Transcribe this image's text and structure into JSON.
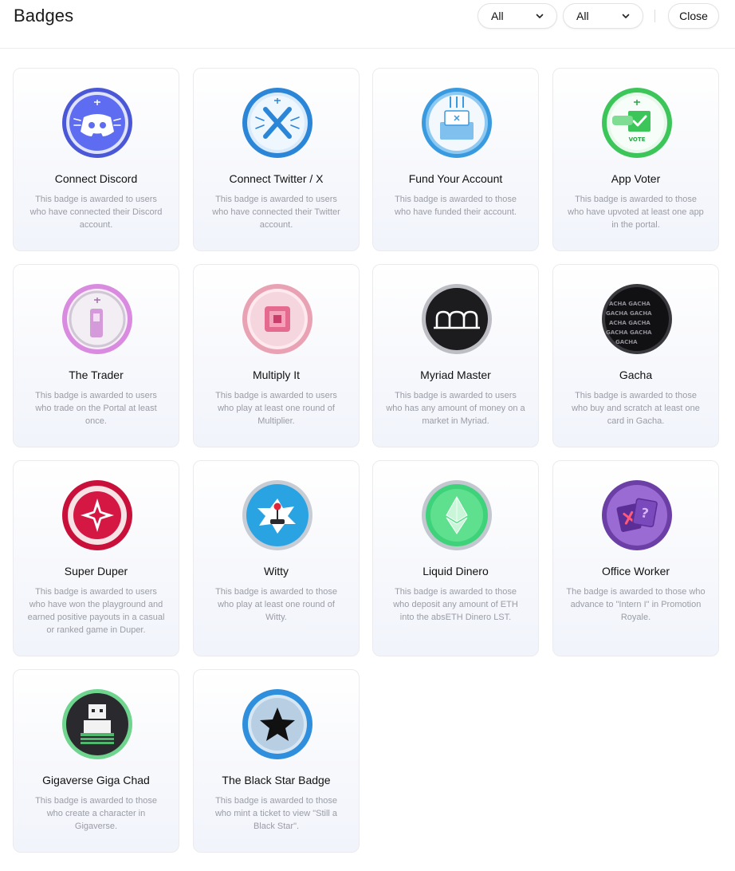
{
  "header": {
    "title": "Badges",
    "filter1": "All",
    "filter2": "All",
    "close_label": "Close"
  },
  "colors": {
    "border": "#ebebef",
    "desc_text": "#9a9ca6",
    "card_bg_bottom": "#f1f4fb"
  },
  "badges": [
    {
      "name": "Connect Discord",
      "desc": "This badge is awarded to users who have connected their Discord account.",
      "icon": "discord-icon"
    },
    {
      "name": "Connect Twitter / X",
      "desc": "This badge is awarded to users who have connected their Twitter account.",
      "icon": "x-logo-icon"
    },
    {
      "name": "Fund Your Account",
      "desc": "This badge is awarded to those who have funded their account.",
      "icon": "fund-box-icon"
    },
    {
      "name": "App Voter",
      "desc": "This badge is awarded to those who have upvoted at least one app in the portal.",
      "icon": "vote-check-icon"
    },
    {
      "name": "The Trader",
      "desc": "This badge is awarded to users who trade on the Portal at least once.",
      "icon": "trader-icon"
    },
    {
      "name": "Multiply It",
      "desc": "This badge is awarded to users who play at least one round of Multiplier.",
      "icon": "multiplier-icon"
    },
    {
      "name": "Myriad Master",
      "desc": "This badge is awarded to users who has any amount of money on a market in Myriad.",
      "icon": "myriad-icon"
    },
    {
      "name": "Gacha",
      "desc": "This badge is awarded to those who buy and scratch at least one card in Gacha.",
      "icon": "gacha-icon"
    },
    {
      "name": "Super Duper",
      "desc": "This badge is awarded to users who have won the playground and earned positive payouts in a casual or ranked game in Duper.",
      "icon": "star-compass-icon"
    },
    {
      "name": "Witty",
      "desc": "This badge is awarded to those who play at least one round of Witty.",
      "icon": "joystick-icon"
    },
    {
      "name": "Liquid Dinero",
      "desc": "This badge is awarded to those who deposit any amount of ETH into the absETH Dinero LST.",
      "icon": "ethereum-icon"
    },
    {
      "name": "Office Worker",
      "desc": "The badge is awarded to those who advance to \"Intern I\" in Promotion Royale.",
      "icon": "cards-icon"
    },
    {
      "name": "Gigaverse Giga Chad",
      "desc": "This badge is awarded to those who create a character in Gigaverse.",
      "icon": "pixel-character-icon"
    },
    {
      "name": "The Black Star Badge",
      "desc": "This badge is awarded to those who mint a ticket to view \"Still a Black Star\".",
      "icon": "black-star-icon"
    }
  ]
}
